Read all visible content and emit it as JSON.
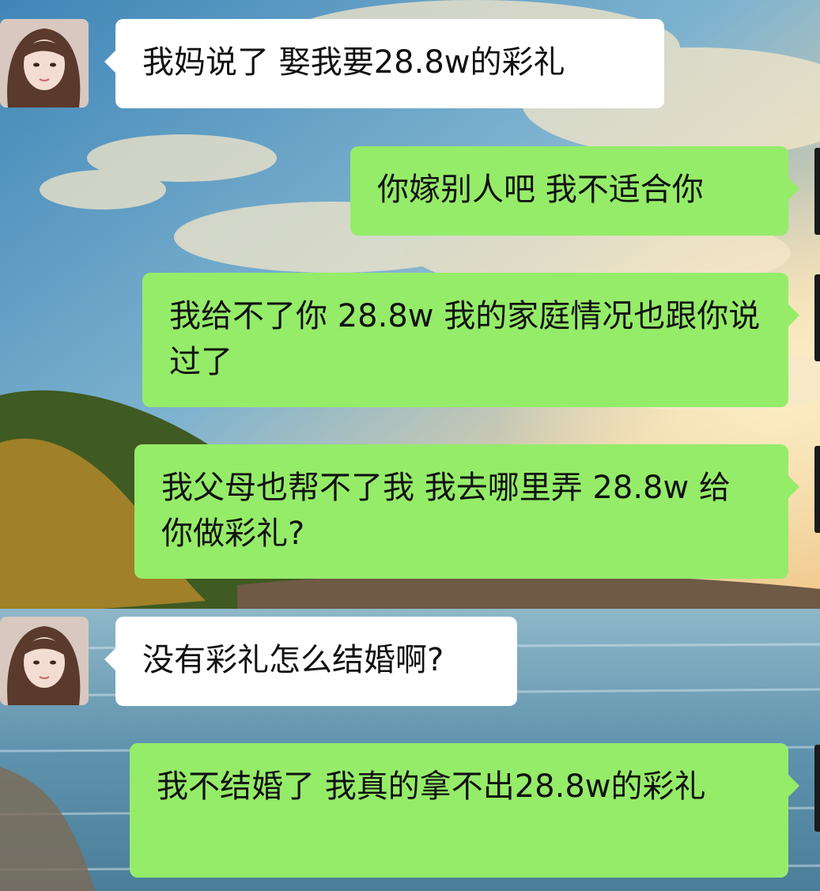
{
  "colors": {
    "incoming_bubble": "#ffffff",
    "outgoing_bubble": "#95ec69",
    "text": "#111111"
  },
  "messages": [
    {
      "side": "incoming",
      "avatar_icon": "girl-photo-avatar",
      "text": "我妈说了  娶我要28.8w的彩礼"
    },
    {
      "side": "outgoing",
      "text": "你嫁别人吧  我不适合你"
    },
    {
      "side": "outgoing",
      "text": "我给不了你 28.8w 我的家庭情况也跟你说过了"
    },
    {
      "side": "outgoing",
      "text": "我父母也帮不了我  我去哪里弄 28.8w 给你做彩礼?"
    },
    {
      "side": "incoming",
      "avatar_icon": "girl-photo-avatar",
      "text": "没有彩礼怎么结婚啊?"
    },
    {
      "side": "outgoing",
      "text": "我不结婚了  我真的拿不出28.8w的彩礼"
    }
  ]
}
